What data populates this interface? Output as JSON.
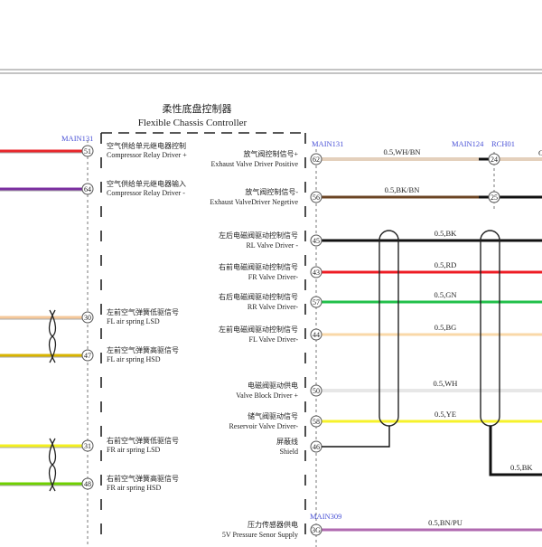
{
  "controller": {
    "title_cn": "柔性底盘控制器",
    "title_en": "Flexible Chassis Controller"
  },
  "connectors": {
    "left": "MAIN131",
    "right_top": "MAIN131",
    "main124": "MAIN124",
    "rch01": "RCH01",
    "main309": "MAIN309"
  },
  "left_pins": [
    {
      "pin": "51",
      "cn": "空气供给单元继电器控制",
      "en": "Compressor Relay Driver +",
      "color": "#e8262b"
    },
    {
      "pin": "64",
      "cn": "空气供给单元继电器输入",
      "en": "Compressor Relay Driver -",
      "color": "#7b2fa0"
    },
    {
      "pin": "30",
      "cn": "左前空气弹簧低驱信号",
      "en": "FL air spring LSD",
      "color": "#f5c89a"
    },
    {
      "pin": "47",
      "cn": "左前空气弹簧高驱信号",
      "en": "FL air spring HSD",
      "color": "#d8b400"
    },
    {
      "pin": "31",
      "cn": "右前空气弹簧低驱信号",
      "en": "FR air spring LSD",
      "color": "#f4f020"
    },
    {
      "pin": "48",
      "cn": "右前空气弹簧高驱信号",
      "en": "FR air spring HSD",
      "color": "#6fd000"
    }
  ],
  "right_pins": [
    {
      "pin": "62",
      "cn": "放气阀控制信号+",
      "en": "Exhaust Valve Driver Positive",
      "wire": "0.5,WH/BN",
      "color": "#c9a27a"
    },
    {
      "pin": "56",
      "cn": "放气阀控制信号-",
      "en": "Exhaust ValveDriver Negetive",
      "wire": "0.5,BK/BN",
      "color": "#6b4423"
    },
    {
      "pin": "45",
      "cn": "左后电磁阀驱动控制信号",
      "en": "RL Valve Driver -",
      "wire": "0.5,BK",
      "color": "#111111"
    },
    {
      "pin": "43",
      "cn": "右前电磁阀驱动控制信号",
      "en": "FR Valve Driver-",
      "wire": "0.5,RD",
      "color": "#ee1c24"
    },
    {
      "pin": "57",
      "cn": "右后电磁阀驱动控制信号",
      "en": "RR Valve Driver-",
      "wire": "0.5,GN",
      "color": "#22c04a"
    },
    {
      "pin": "44",
      "cn": "左前电磁阀驱动控制信号",
      "en": "FL Valve Driver-",
      "wire": "0.5,BG",
      "color": "#f9d8a8"
    },
    {
      "pin": "50",
      "cn": "电磁阀驱动供电",
      "en": "Valve Block Driver +",
      "wire": "0.5,WH",
      "color": "#cfcfcf"
    },
    {
      "pin": "58",
      "cn": "储气阀驱动信号",
      "en": "Reservoir Valve Driver-",
      "wire": "0.5,YE",
      "color": "#f6f22a"
    },
    {
      "pin": "46",
      "cn": "屏蔽线",
      "en": "Shield",
      "wire": "",
      "color": "#111111"
    },
    {
      "pin": "3G",
      "cn": "压力传感器供电",
      "en": "5V Pressure Senor Supply",
      "wire": "0.5,BN/PU",
      "color": "#b06ab0"
    }
  ],
  "far_pins": {
    "a": "24",
    "b": "25"
  },
  "shield_wire": "0.5,BK"
}
